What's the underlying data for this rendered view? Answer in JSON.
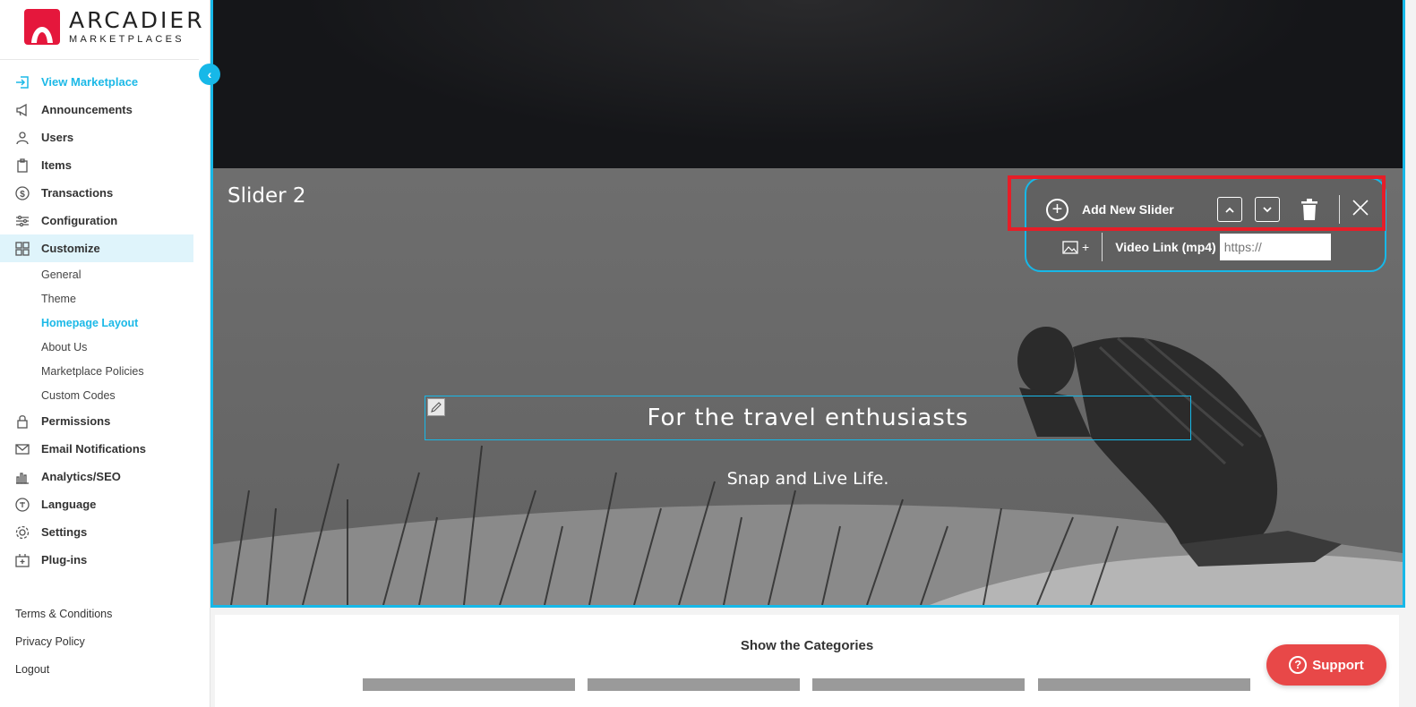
{
  "brand": {
    "title": "ARCADIER",
    "subtitle": "MARKETPLACES",
    "accent": "#17b8e8",
    "logo_color": "#e5173c"
  },
  "sidebar": {
    "collapse_icon": "chevron-left-icon",
    "items": [
      {
        "label": "View Marketplace",
        "icon": "enter-icon"
      },
      {
        "label": "Announcements",
        "icon": "megaphone-icon"
      },
      {
        "label": "Users",
        "icon": "user-icon"
      },
      {
        "label": "Items",
        "icon": "clipboard-icon"
      },
      {
        "label": "Transactions",
        "icon": "dollar-icon"
      },
      {
        "label": "Configuration",
        "icon": "sliders-icon"
      },
      {
        "label": "Customize",
        "icon": "grid-icon"
      }
    ],
    "customize_sub": [
      "General",
      "Theme",
      "Homepage Layout",
      "About Us",
      "Marketplace Policies",
      "Custom Codes"
    ],
    "items_after": [
      {
        "label": "Permissions",
        "icon": "lock-icon"
      },
      {
        "label": "Email Notifications",
        "icon": "mail-icon"
      },
      {
        "label": "Analytics/SEO",
        "icon": "bar-chart-icon"
      },
      {
        "label": "Language",
        "icon": "translate-icon"
      },
      {
        "label": "Settings",
        "icon": "gear-icon"
      },
      {
        "label": "Plug-ins",
        "icon": "plugin-icon"
      }
    ],
    "footer": [
      "Terms & Conditions",
      "Privacy Policy",
      "Logout"
    ]
  },
  "slider": {
    "label": "Slider 2",
    "headline": "For the travel enthusiasts",
    "subline": "Snap and Live Life.",
    "toolbar": {
      "add_label": "Add New Slider",
      "video_label": "Video Link (mp4)",
      "video_placeholder": "https://",
      "image_add_label": "+"
    }
  },
  "categories": {
    "title": "Show the Categories"
  },
  "support": {
    "label": "Support"
  }
}
